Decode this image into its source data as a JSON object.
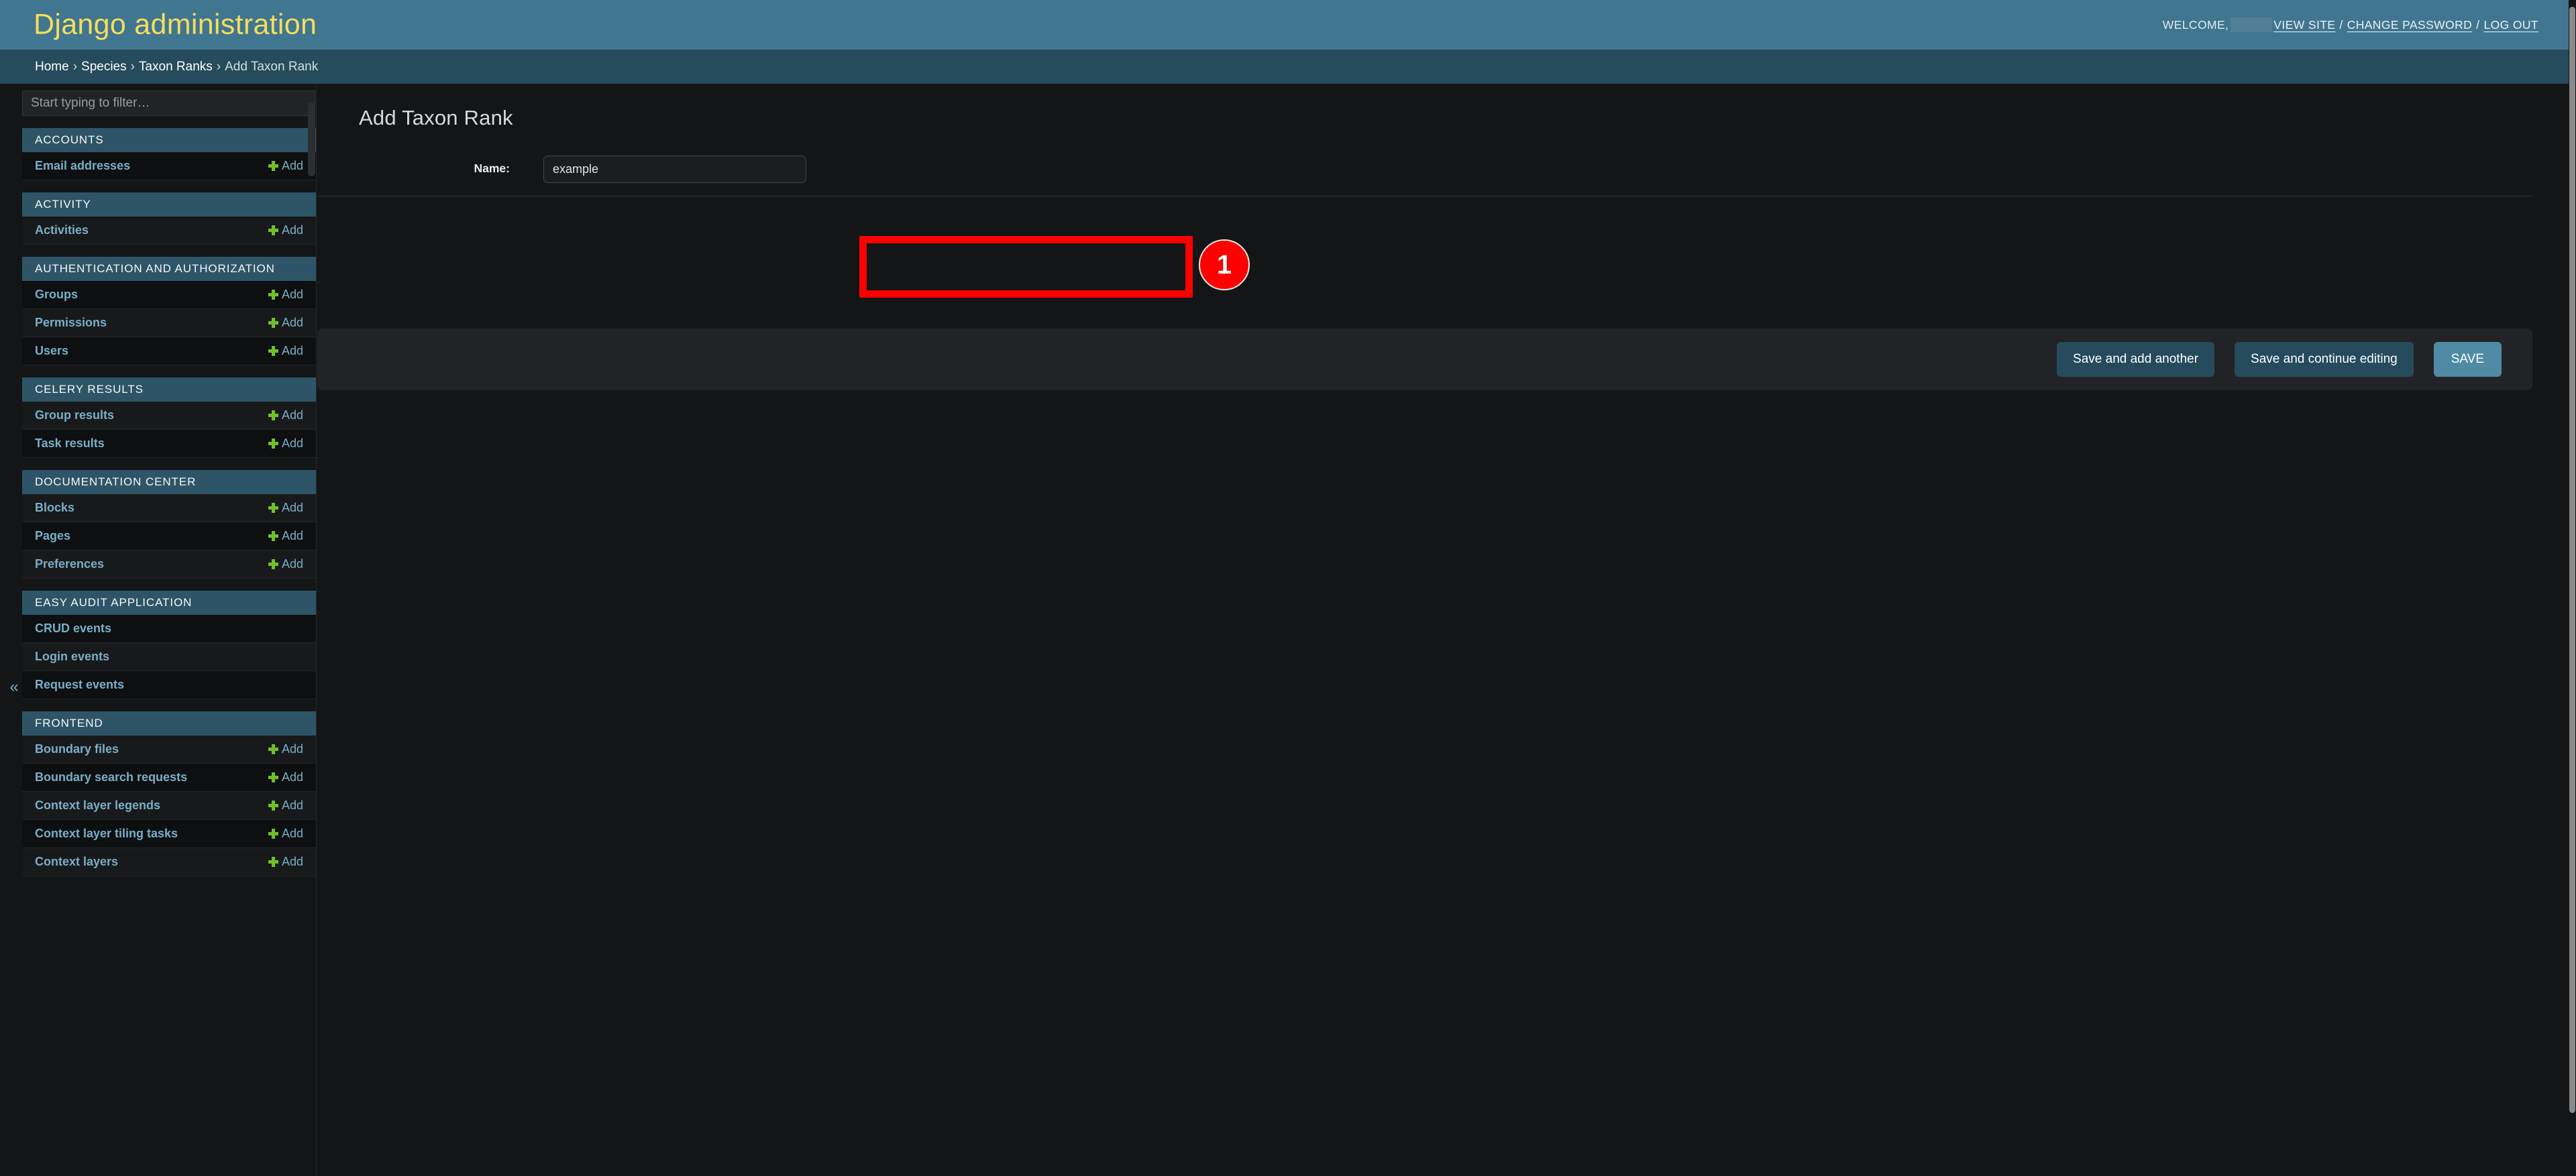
{
  "header": {
    "branding": "Django administration",
    "welcome_label": "WELCOME,",
    "username_redacted": "",
    "links": [
      {
        "label": "VIEW SITE"
      },
      {
        "label": "CHANGE PASSWORD"
      },
      {
        "label": "LOG OUT"
      }
    ],
    "separator": "/"
  },
  "breadcrumbs": {
    "chevron": "›",
    "items": [
      {
        "label": "Home",
        "current": false
      },
      {
        "label": "Species",
        "current": false
      },
      {
        "label": "Taxon Ranks",
        "current": false
      },
      {
        "label": "Add Taxon Rank",
        "current": true
      }
    ]
  },
  "sidebar": {
    "filter_placeholder": "Start typing to filter…",
    "filter_value": "",
    "collapse_icon": "«",
    "add_label": "Add",
    "apps": [
      {
        "title": "ACCOUNTS",
        "models": [
          {
            "name": "Email addresses",
            "add": true
          }
        ]
      },
      {
        "title": "ACTIVITY",
        "models": [
          {
            "name": "Activities",
            "add": true
          }
        ]
      },
      {
        "title": "AUTHENTICATION AND AUTHORIZATION",
        "models": [
          {
            "name": "Groups",
            "add": true
          },
          {
            "name": "Permissions",
            "add": true
          },
          {
            "name": "Users",
            "add": true
          }
        ]
      },
      {
        "title": "CELERY RESULTS",
        "models": [
          {
            "name": "Group results",
            "add": true
          },
          {
            "name": "Task results",
            "add": true
          }
        ]
      },
      {
        "title": "DOCUMENTATION CENTER",
        "models": [
          {
            "name": "Blocks",
            "add": true
          },
          {
            "name": "Pages",
            "add": true
          },
          {
            "name": "Preferences",
            "add": true
          }
        ]
      },
      {
        "title": "EASY AUDIT APPLICATION",
        "models": [
          {
            "name": "CRUD events",
            "add": false
          },
          {
            "name": "Login events",
            "add": false
          },
          {
            "name": "Request events",
            "add": false
          }
        ]
      },
      {
        "title": "FRONTEND",
        "models": [
          {
            "name": "Boundary files",
            "add": true
          },
          {
            "name": "Boundary search requests",
            "add": true
          },
          {
            "name": "Context layer legends",
            "add": true
          },
          {
            "name": "Context layer tiling tasks",
            "add": true
          },
          {
            "name": "Context layers",
            "add": true
          }
        ]
      }
    ]
  },
  "content": {
    "title": "Add Taxon Rank",
    "form_rows": [
      {
        "label": "Name:",
        "value": "example",
        "placeholder": ""
      }
    ]
  },
  "submit_row": {
    "save_and_add_another": "Save and add another",
    "save_and_continue": "Save and continue editing",
    "save": "SAVE"
  },
  "annotation": {
    "badge_number": "1",
    "highlight_color": "#fe0000"
  }
}
